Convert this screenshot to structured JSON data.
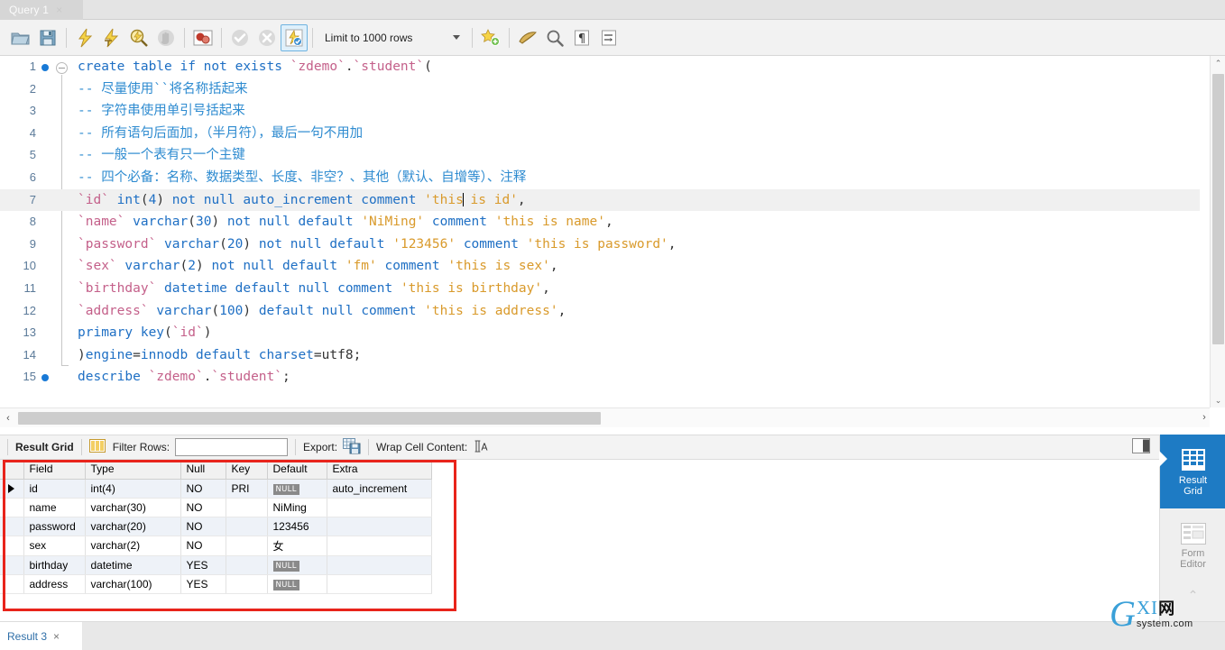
{
  "window": {
    "tab": {
      "label": "Query 1",
      "close": "×"
    }
  },
  "toolbar": {
    "icons": [
      {
        "name": "open-sql-script-icon",
        "title": "Open a SQL script file in a new query tab"
      },
      {
        "name": "save-script-icon",
        "title": "Save the script to a file"
      },
      {
        "name": "execute-statements-icon",
        "title": "Execute the selected portion of the script"
      },
      {
        "name": "execute-current-statement-icon",
        "title": "Execute the statement under the keyboard cursor"
      },
      {
        "name": "explain-statement-icon",
        "title": "Explain current statement"
      },
      {
        "name": "stop-execution-icon",
        "title": "Stop the query being executed"
      },
      {
        "name": "toggle-stop-on-error-icon",
        "title": "Toggle whether execution should stop on errors"
      },
      {
        "name": "commit-icon",
        "title": "Commit"
      },
      {
        "name": "rollback-icon",
        "title": "Rollback"
      },
      {
        "name": "toggle-autocommit-icon",
        "title": "Toggle autocommit mode"
      }
    ],
    "limit_label": "Limit to 1000 rows",
    "right_icons": [
      {
        "name": "save-snippet-icon",
        "title": "Save current statement to snippets"
      },
      {
        "name": "beautify-query-icon",
        "title": "Beautify/reformat the SQL script"
      },
      {
        "name": "find-icon",
        "title": "Show the Find panel"
      },
      {
        "name": "toggle-invisible-chars-icon",
        "title": "Toggle invisible characters"
      },
      {
        "name": "wrap-lines-icon",
        "title": "Toggle wrapping of long lines"
      }
    ]
  },
  "editor": {
    "lines": [
      {
        "num": "1",
        "breakpoint": true,
        "fold": "start",
        "tokens": [
          {
            "t": "create table if not exists ",
            "c": "k"
          },
          {
            "t": "`zdemo`",
            "c": "id"
          },
          {
            "t": ".",
            "c": "pl"
          },
          {
            "t": "`student`",
            "c": "id"
          },
          {
            "t": "(",
            "c": "pl"
          }
        ]
      },
      {
        "num": "2",
        "breakpoint": false,
        "fold": "mid",
        "tokens": [
          {
            "t": "-- 尽量使用``将名称括起来",
            "c": "cm"
          }
        ]
      },
      {
        "num": "3",
        "breakpoint": false,
        "fold": "mid",
        "tokens": [
          {
            "t": "-- 字符串使用单引号括起来",
            "c": "cm"
          }
        ]
      },
      {
        "num": "4",
        "breakpoint": false,
        "fold": "mid",
        "tokens": [
          {
            "t": "-- 所有语句后面加，（半月符），最后一句不用加",
            "c": "cm"
          }
        ]
      },
      {
        "num": "5",
        "breakpoint": false,
        "fold": "mid",
        "tokens": [
          {
            "t": "-- 一般一个表有只一个主键",
            "c": "cm"
          }
        ]
      },
      {
        "num": "6",
        "breakpoint": false,
        "fold": "mid",
        "tokens": [
          {
            "t": "-- 四个必备：名称、数据类型、长度、非空？、其他（默认、自增等）、注释",
            "c": "cm"
          }
        ]
      },
      {
        "num": "7",
        "breakpoint": false,
        "fold": "mid",
        "highlight": true,
        "tokens": [
          {
            "t": "`id`",
            "c": "id"
          },
          {
            "t": " ",
            "c": "pl"
          },
          {
            "t": "int",
            "c": "k"
          },
          {
            "t": "(",
            "c": "pl"
          },
          {
            "t": "4",
            "c": "nu"
          },
          {
            "t": ") ",
            "c": "pl"
          },
          {
            "t": "not null auto_increment comment ",
            "c": "k"
          },
          {
            "t": "'this",
            "c": "st"
          },
          {
            "t": "CARET",
            "c": "caret"
          },
          {
            "t": " is id'",
            "c": "st"
          },
          {
            "t": ",",
            "c": "pl"
          }
        ]
      },
      {
        "num": "8",
        "breakpoint": false,
        "fold": "mid",
        "tokens": [
          {
            "t": "`name`",
            "c": "id"
          },
          {
            "t": " ",
            "c": "pl"
          },
          {
            "t": "varchar",
            "c": "k"
          },
          {
            "t": "(",
            "c": "pl"
          },
          {
            "t": "30",
            "c": "nu"
          },
          {
            "t": ") ",
            "c": "pl"
          },
          {
            "t": "not null default ",
            "c": "k"
          },
          {
            "t": "'NiMing'",
            "c": "st"
          },
          {
            "t": " ",
            "c": "pl"
          },
          {
            "t": "comment ",
            "c": "k"
          },
          {
            "t": "'this is name'",
            "c": "st"
          },
          {
            "t": ",",
            "c": "pl"
          }
        ]
      },
      {
        "num": "9",
        "breakpoint": false,
        "fold": "mid",
        "tokens": [
          {
            "t": "`password`",
            "c": "id"
          },
          {
            "t": " ",
            "c": "pl"
          },
          {
            "t": "varchar",
            "c": "k"
          },
          {
            "t": "(",
            "c": "pl"
          },
          {
            "t": "20",
            "c": "nu"
          },
          {
            "t": ") ",
            "c": "pl"
          },
          {
            "t": "not null default ",
            "c": "k"
          },
          {
            "t": "'123456'",
            "c": "st"
          },
          {
            "t": " ",
            "c": "pl"
          },
          {
            "t": "comment ",
            "c": "k"
          },
          {
            "t": "'this is password'",
            "c": "st"
          },
          {
            "t": ",",
            "c": "pl"
          }
        ]
      },
      {
        "num": "10",
        "breakpoint": false,
        "fold": "mid",
        "tokens": [
          {
            "t": "`sex`",
            "c": "id"
          },
          {
            "t": " ",
            "c": "pl"
          },
          {
            "t": "varchar",
            "c": "k"
          },
          {
            "t": "(",
            "c": "pl"
          },
          {
            "t": "2",
            "c": "nu"
          },
          {
            "t": ") ",
            "c": "pl"
          },
          {
            "t": "not null default ",
            "c": "k"
          },
          {
            "t": "'fm'",
            "c": "st"
          },
          {
            "t": " ",
            "c": "pl"
          },
          {
            "t": "comment ",
            "c": "k"
          },
          {
            "t": "'this is sex'",
            "c": "st"
          },
          {
            "t": ",",
            "c": "pl"
          }
        ]
      },
      {
        "num": "11",
        "breakpoint": false,
        "fold": "mid",
        "tokens": [
          {
            "t": "`birthday`",
            "c": "id"
          },
          {
            "t": " ",
            "c": "pl"
          },
          {
            "t": "datetime default null comment ",
            "c": "k"
          },
          {
            "t": "'this is birthday'",
            "c": "st"
          },
          {
            "t": ",",
            "c": "pl"
          }
        ]
      },
      {
        "num": "12",
        "breakpoint": false,
        "fold": "mid",
        "tokens": [
          {
            "t": "`address`",
            "c": "id"
          },
          {
            "t": " ",
            "c": "pl"
          },
          {
            "t": "varchar",
            "c": "k"
          },
          {
            "t": "(",
            "c": "pl"
          },
          {
            "t": "100",
            "c": "nu"
          },
          {
            "t": ") ",
            "c": "pl"
          },
          {
            "t": "default null comment ",
            "c": "k"
          },
          {
            "t": "'this is address'",
            "c": "st"
          },
          {
            "t": ",",
            "c": "pl"
          }
        ]
      },
      {
        "num": "13",
        "breakpoint": false,
        "fold": "mid",
        "tokens": [
          {
            "t": "primary key",
            "c": "k"
          },
          {
            "t": "(",
            "c": "pl"
          },
          {
            "t": "`id`",
            "c": "id"
          },
          {
            "t": ")",
            "c": "pl"
          }
        ]
      },
      {
        "num": "14",
        "breakpoint": false,
        "fold": "end",
        "tokens": [
          {
            "t": ")",
            "c": "pl"
          },
          {
            "t": "engine",
            "c": "k"
          },
          {
            "t": "=",
            "c": "pl"
          },
          {
            "t": "innodb default charset",
            "c": "k"
          },
          {
            "t": "=utf8;",
            "c": "pl"
          }
        ]
      },
      {
        "num": "15",
        "breakpoint": true,
        "fold": "none",
        "tokens": [
          {
            "t": "describe ",
            "c": "k"
          },
          {
            "t": "`zdemo`",
            "c": "id"
          },
          {
            "t": ".",
            "c": "pl"
          },
          {
            "t": "`student`",
            "c": "id"
          },
          {
            "t": ";",
            "c": "pl"
          }
        ]
      }
    ],
    "scroll_up": "⌃",
    "scroll_down": "⌄",
    "scroll_left": "‹",
    "scroll_right": "›"
  },
  "result_toolbar": {
    "title": "Result Grid",
    "filter_label": "Filter Rows:",
    "filter_value": "",
    "filter_placeholder": "",
    "export_label": "Export:",
    "wrap_label": "Wrap Cell Content:",
    "wrap_icon_text": "⩛A"
  },
  "result_grid": {
    "columns": [
      "Field",
      "Type",
      "Null",
      "Key",
      "Default",
      "Extra"
    ],
    "rows": [
      {
        "selected": true,
        "Field": "id",
        "Type": "int(4)",
        "Null": "NO",
        "Key": "PRI",
        "Default": "NULL",
        "Extra": "auto_increment"
      },
      {
        "selected": false,
        "Field": "name",
        "Type": "varchar(30)",
        "Null": "NO",
        "Key": "",
        "Default": "NiMing",
        "Extra": ""
      },
      {
        "selected": false,
        "Field": "password",
        "Type": "varchar(20)",
        "Null": "NO",
        "Key": "",
        "Default": "123456",
        "Extra": ""
      },
      {
        "selected": false,
        "Field": "sex",
        "Type": "varchar(2)",
        "Null": "NO",
        "Key": "",
        "Default": "女",
        "Extra": ""
      },
      {
        "selected": false,
        "Field": "birthday",
        "Type": "datetime",
        "Null": "YES",
        "Key": "",
        "Default": "NULL",
        "Extra": ""
      },
      {
        "selected": false,
        "Field": "address",
        "Type": "varchar(100)",
        "Null": "YES",
        "Key": "",
        "Default": "NULL",
        "Extra": ""
      }
    ],
    "null_badge_text": "NULL"
  },
  "side_panel": {
    "items": [
      {
        "name": "result-grid",
        "label_line1": "Result",
        "label_line2": "Grid",
        "active": true
      },
      {
        "name": "form-editor",
        "label_line1": "Form",
        "label_line2": "Editor",
        "active": false
      }
    ],
    "collapse_arrow": "⌃"
  },
  "bottom": {
    "tab_label": "Result 3",
    "tab_close": "×"
  },
  "watermark": {
    "big": "G",
    "mid": "XI",
    "cjk": "网",
    "sub": "system.com"
  },
  "colors": {
    "accent_blue": "#1e7bc4",
    "annotation_red": "#e8241b",
    "keyword": "#1e6fc4",
    "identifier": "#c4608a",
    "string": "#d99a2b",
    "comment": "#2e8bd0"
  }
}
